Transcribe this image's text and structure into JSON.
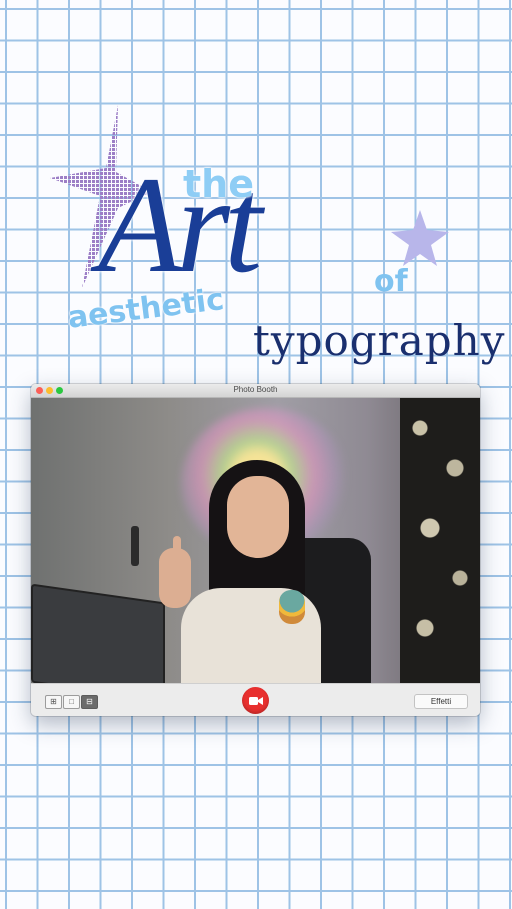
{
  "title": {
    "the": "the",
    "art": "Art",
    "of": "of",
    "aesthetic": "aesthetic",
    "typography": "typography"
  },
  "colors": {
    "grid": "#9ec3e6",
    "title_dark": "#1a3e97",
    "title_light": "#7fc3f0",
    "star": "#b8b6ea",
    "record": "#e8302f"
  },
  "window": {
    "title": "Photo Booth",
    "buttons": {
      "close": "close",
      "minimize": "minimize",
      "zoom": "zoom"
    }
  },
  "toolbar": {
    "view_modes": [
      {
        "icon": "four-up-icon",
        "glyph": "⊞",
        "selected": false
      },
      {
        "icon": "single-photo-icon",
        "glyph": "□",
        "selected": false
      },
      {
        "icon": "video-mode-icon",
        "glyph": "⊟",
        "selected": true
      }
    ],
    "record_icon": "video-camera-icon",
    "effects_label": "Effetti"
  }
}
